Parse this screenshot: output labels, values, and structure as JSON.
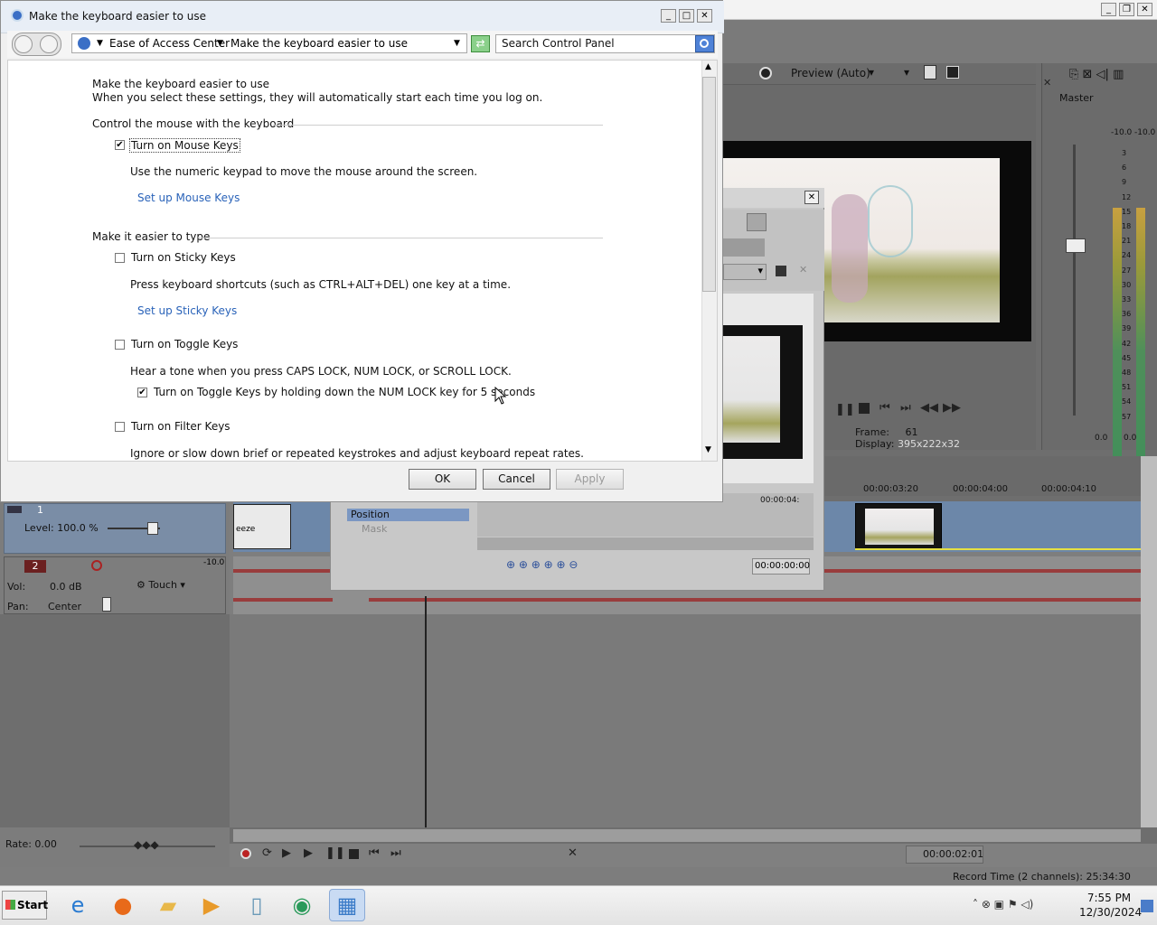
{
  "window": {
    "title": "Make the keyboard easier to use",
    "controls": {
      "minimize": "_",
      "maximize": "□",
      "close": "✕"
    }
  },
  "address_bar": {
    "segments": [
      "Ease of Access Center",
      "Make the keyboard easier to use"
    ],
    "separator": "▸"
  },
  "search": {
    "placeholder": "Search Control Panel"
  },
  "content": {
    "heading": "Make the keyboard easier to use",
    "intro": "When you select these settings, they will automatically start each time you log on.",
    "sections": [
      {
        "title": "Control the mouse with the keyboard",
        "options": [
          {
            "label": "Turn on Mouse Keys",
            "checked": true,
            "description": "Use the numeric keypad to move the mouse around the screen.",
            "link": "Set up Mouse Keys"
          }
        ]
      },
      {
        "title": "Make it easier to type",
        "options": [
          {
            "label": "Turn on Sticky Keys",
            "checked": false,
            "description": "Press keyboard shortcuts (such as CTRL+ALT+DEL) one key at a time.",
            "link": "Set up Sticky Keys"
          },
          {
            "label": "Turn on Toggle Keys",
            "checked": false,
            "description": "Hear a tone when you press CAPS LOCK, NUM LOCK, or SCROLL LOCK.",
            "sub_option": {
              "label": "Turn on Toggle Keys by holding down the NUM LOCK key for 5 seconds",
              "checked": true
            }
          },
          {
            "label": "Turn on Filter Keys",
            "checked": false,
            "description": "Ignore or slow down brief or repeated keystrokes and adjust keyboard repeat rates."
          }
        ]
      }
    ]
  },
  "buttons": {
    "ok": "OK",
    "cancel": "Cancel",
    "apply": "Apply"
  },
  "editor": {
    "preview_label": "Preview (Auto)",
    "frame_label": "Frame:",
    "frame_value": "61",
    "display_label": "Display:",
    "display_value": "395x222x32",
    "master_label": "Master",
    "master_levels": [
      "-10.0",
      "-10.0"
    ],
    "meter_ticks": [
      "3",
      "6",
      "9",
      "12",
      "15",
      "18",
      "21",
      "24",
      "27",
      "30",
      "33",
      "36",
      "39",
      "42",
      "45",
      "48",
      "51",
      "54",
      "57"
    ],
    "meter_bottom": [
      "0.0",
      "0.0"
    ],
    "ruler": [
      "00:00:03:20",
      "00:00:04:00",
      "00:00:04:10"
    ],
    "panel_ruler": "00:00:04:",
    "track1": {
      "number": "1",
      "level": "Level: 100.0 %"
    },
    "track2": {
      "number": "2",
      "vol_label": "Vol:",
      "vol_value": "0.0 dB",
      "pan_label": "Pan:",
      "pan_value": "Center",
      "touch": "Touch",
      "meter_top": "-10.0"
    },
    "clip_label": "eeze",
    "rate": "Rate: 0.00",
    "timecode": "00:00:02:01",
    "record_time": "Record Time (2 channels): 25:34:30",
    "panel": {
      "position": "Position",
      "mask": "Mask",
      "timecode": "00:00:00:00"
    }
  },
  "taskbar": {
    "start": "Start",
    "time": "7:55 PM",
    "date": "12/30/2024"
  },
  "colors": {
    "accent": "#2a63b9",
    "titlebar": "#e8eef6",
    "waveform": "#9b2f2f"
  }
}
